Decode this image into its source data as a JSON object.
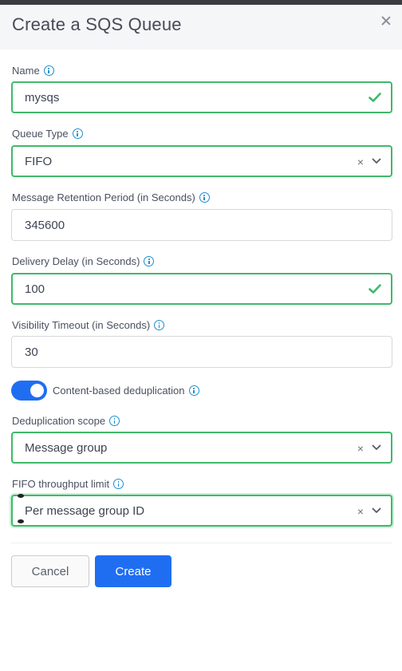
{
  "dialog": {
    "title": "Create a SQS Queue"
  },
  "fields": {
    "name": {
      "label": "Name",
      "value": "mysqs"
    },
    "queue_type": {
      "label": "Queue Type",
      "value": "FIFO"
    },
    "retention": {
      "label": "Message Retention Period (in Seconds)",
      "value": "345600"
    },
    "delivery_delay": {
      "label": "Delivery Delay (in Seconds)",
      "value": "100"
    },
    "visibility_timeout": {
      "label": "Visibility Timeout (in Seconds)",
      "value": "30"
    },
    "content_dedup": {
      "label": "Content-based deduplication",
      "enabled": true
    },
    "dedup_scope": {
      "label": "Deduplication scope",
      "value": "Message group"
    },
    "throughput_limit": {
      "label": "FIFO throughput limit",
      "value": "Per message group ID"
    }
  },
  "select_clear_glyph": "×",
  "buttons": {
    "cancel": "Cancel",
    "create": "Create"
  },
  "colors": {
    "accent": "#1f6ef2",
    "valid": "#3fb96a",
    "info": "#1a8fd0"
  },
  "icons": [
    "close-icon",
    "info-icon",
    "check-icon",
    "chevron-down-icon",
    "clear-icon"
  ]
}
